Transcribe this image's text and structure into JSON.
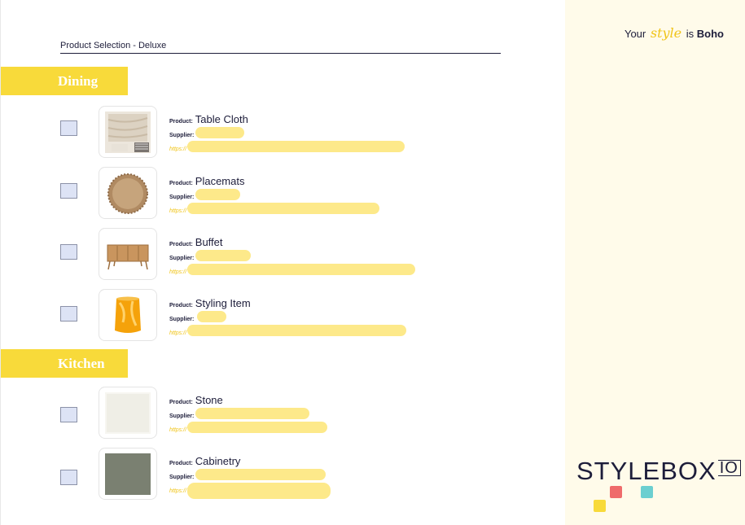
{
  "header": {
    "tagline_prefix": "Your",
    "tagline_style": "style",
    "tagline_is": "is",
    "tagline_brand_style": "Boho",
    "doc_title": "Product Selection - Deluxe"
  },
  "labels": {
    "product": "Product:",
    "supplier": "Supplier:",
    "url_prefix": "https://"
  },
  "sections": [
    {
      "title": "Dining",
      "items": [
        {
          "product": "Table Cloth",
          "image_icon": "table-cloth-image"
        },
        {
          "product": "Placemats",
          "image_icon": "placemats-image"
        },
        {
          "product": "Buffet",
          "image_icon": "buffet-image"
        },
        {
          "product": "Styling Item",
          "image_icon": "candle-holder-image"
        }
      ]
    },
    {
      "title": "Kitchen",
      "items": [
        {
          "product": "Stone",
          "image_icon": "stone-swatch-image"
        },
        {
          "product": "Cabinetry",
          "image_icon": "cabinetry-swatch-image"
        }
      ]
    }
  ],
  "logo": {
    "text_a": "STYLE",
    "text_b": "BOX",
    "text_c": "IO"
  },
  "colors": {
    "accent_yellow": "#f8da3a",
    "panel_cream": "#fffbea",
    "navy": "#1d1d3a",
    "logo_red": "#ef6b6b",
    "logo_teal": "#6ccfd0",
    "logo_yellow": "#f8da3a"
  }
}
